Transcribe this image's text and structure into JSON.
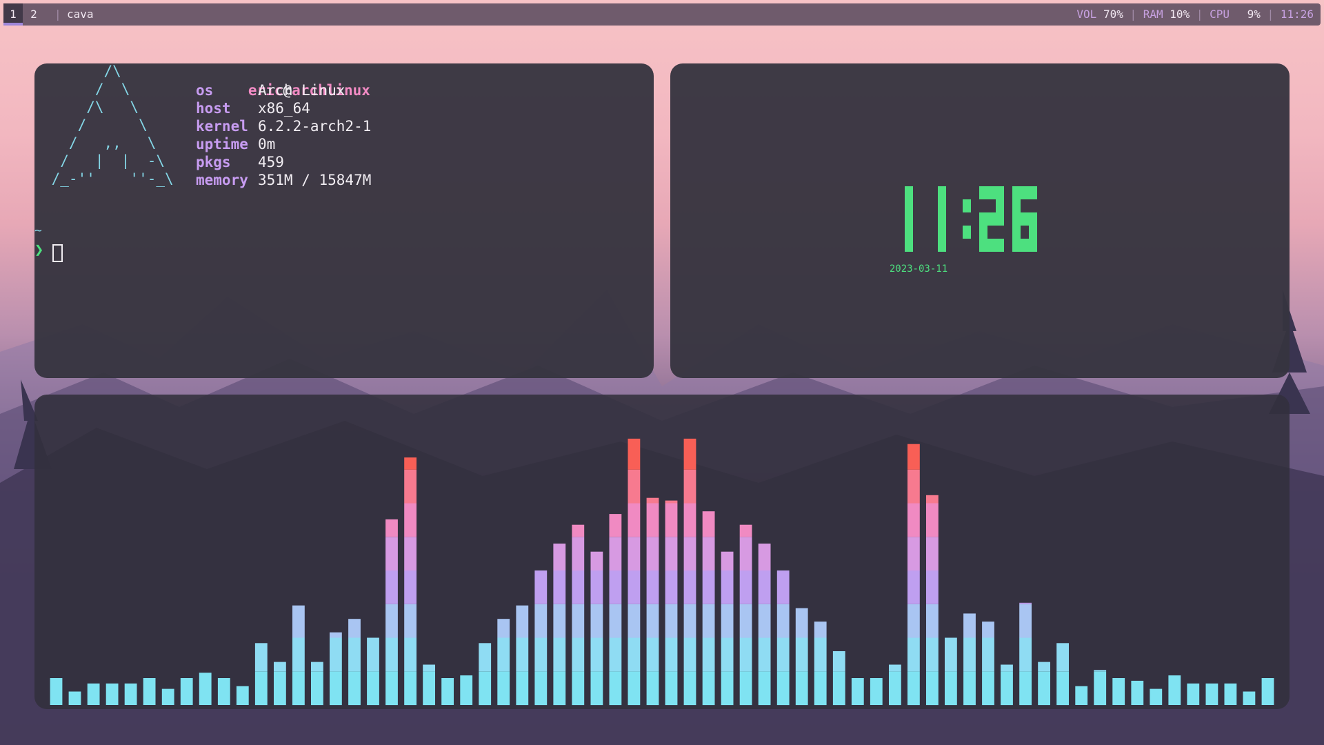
{
  "topbar": {
    "workspaces": [
      "1",
      "2"
    ],
    "active_workspace": "1",
    "window_title": "cava",
    "status": [
      {
        "key": "VOL",
        "value": "70%"
      },
      {
        "key": "RAM",
        "value": "10%"
      },
      {
        "key": "CPU",
        "value": "9%"
      }
    ],
    "time": "11:26"
  },
  "terminal": {
    "ascii_art": "       /\\\n      /  \\\n     /\\   \\\n    /      \\\n   /   ,,   \\\n  /   |  |  -\\\n /_-''    ''-_\\",
    "user": "eric",
    "at": "@",
    "host_name": "archlinux",
    "info": [
      {
        "key": "os",
        "value": "Arch Linux"
      },
      {
        "key": "host",
        "value": "x86_64"
      },
      {
        "key": "kernel",
        "value": "6.2.2-arch2-1"
      },
      {
        "key": "uptime",
        "value": "0m"
      },
      {
        "key": "pkgs",
        "value": "459"
      },
      {
        "key": "memory",
        "value": "351M / 15847M"
      }
    ],
    "cwd": "~",
    "prompt_symbol": "❯"
  },
  "clock": {
    "time": "11:26",
    "date": "2023-03-11",
    "color": "#4de07f"
  },
  "visualizer": {
    "levels": [
      0.1,
      0.05,
      0.08,
      0.08,
      0.08,
      0.1,
      0.06,
      0.1,
      0.12,
      0.1,
      0.07,
      0.23,
      0.16,
      0.37,
      0.16,
      0.27,
      0.32,
      0.25,
      0.69,
      0.92,
      0.15,
      0.1,
      0.11,
      0.23,
      0.32,
      0.37,
      0.5,
      0.6,
      0.67,
      0.57,
      0.71,
      0.99,
      0.77,
      0.76,
      0.99,
      0.72,
      0.57,
      0.67,
      0.6,
      0.5,
      0.36,
      0.31,
      0.2,
      0.1,
      0.1,
      0.15,
      0.97,
      0.78,
      0.25,
      0.34,
      0.31,
      0.15,
      0.38,
      0.16,
      0.23,
      0.07,
      0.13,
      0.1,
      0.09,
      0.06,
      0.11,
      0.08,
      0.08,
      0.08,
      0.05,
      0.1
    ],
    "gradient": [
      "#7fe3f2",
      "#8fdcf3",
      "#a9c5f2",
      "#bf9ff0",
      "#d79ae2",
      "#f08ac2",
      "#f77a8f",
      "#f85f56"
    ]
  }
}
